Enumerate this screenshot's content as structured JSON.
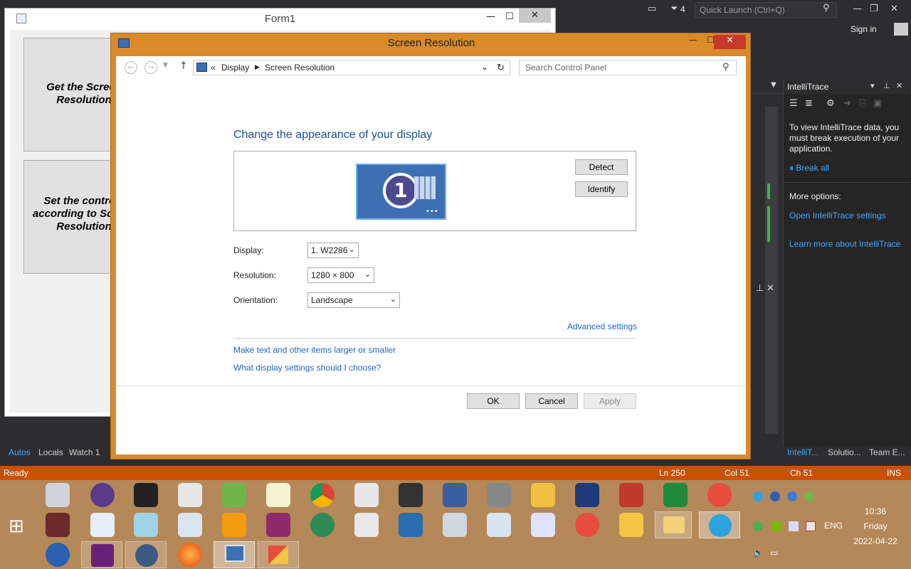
{
  "vs": {
    "quick_launch_placeholder": "Quick Launch (Ctrl+Q)",
    "notification_count": "4",
    "sign_in": "Sign in",
    "status": {
      "ready": "Ready",
      "ln": "Ln 250",
      "col": "Col 51",
      "ch": "Ch 51",
      "ins": "INS"
    },
    "left_tabs": [
      "Autos",
      "Locals",
      "Watch 1"
    ],
    "right_tabs": [
      "IntelliT...",
      "Solutio...",
      "Team E..."
    ],
    "intellitrace": {
      "title": "IntelliTrace",
      "message": "To view IntelliTrace data, you must break execution of your application.",
      "break_all": "Break all",
      "more_options": "More options:",
      "open_settings": "Open IntelliTrace settings",
      "learn_more": "Learn more about IntelliTrace"
    }
  },
  "form1": {
    "title": "Form1",
    "btn_get": "Get the Screen Resolution",
    "btn_set": "Set the controls according to Screen Resolution"
  },
  "sr": {
    "title": "Screen Resolution",
    "breadcrumb": [
      "Display",
      "Screen Resolution"
    ],
    "search_placeholder": "Search Control Panel",
    "heading": "Change the appearance of your display",
    "monitor_number": "1",
    "detect": "Detect",
    "identify": "Identify",
    "display_label": "Display:",
    "display_value": "1. W2286",
    "resolution_label": "Resolution:",
    "resolution_value": "1280 × 800",
    "orientation_label": "Orientation:",
    "orientation_value": "Landscape",
    "advanced": "Advanced settings",
    "link_text_size": "Make text and other items larger or smaller",
    "link_what": "What display settings should I choose?",
    "ok": "OK",
    "cancel": "Cancel",
    "apply": "Apply"
  },
  "taskbar": {
    "time": "10:36",
    "day": "Friday",
    "date": "2022-04-22",
    "lang": "ENG"
  },
  "colors": {
    "accent": "#ca5100",
    "window_frame": "#d98a2b",
    "link": "#1e66c5"
  }
}
